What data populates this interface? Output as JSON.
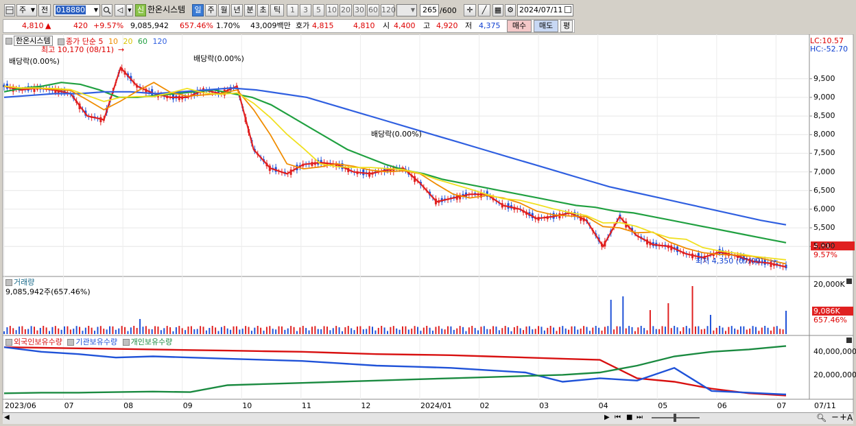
{
  "toolbar": {
    "type_label": "주",
    "prev_label": "전",
    "code_value": "018880",
    "new_badge": "신",
    "stock_name": "한온시스템",
    "period_buttons": [
      "일",
      "주",
      "월",
      "년",
      "분",
      "초",
      "틱"
    ],
    "interval_buttons": [
      "1",
      "3",
      "5",
      "10",
      "20",
      "30",
      "60",
      "120"
    ],
    "count_value": "265",
    "count_max": "/600",
    "date_value": "2024/07/11"
  },
  "quote": {
    "price": "4,810",
    "arrow": "▲",
    "change": "420",
    "change_pct": "+9.57%",
    "volume": "9,085,942",
    "volume_ratio": "657.46%",
    "turnover": "1.70%",
    "amount": "43,009백만",
    "ask_label": "호가",
    "ask": "4,815",
    "bid": "4,810",
    "open_label": "시",
    "open": "4,400",
    "high_label": "고",
    "high": "4,920",
    "low_label": "저",
    "low": "4,375",
    "buy_button": "매수",
    "sell_button": "매도",
    "eval_button": "평"
  },
  "price_panel": {
    "title": "한온시스템",
    "legend_prefix": "종가 단순",
    "ma_periods": [
      "5",
      "10",
      "20",
      "60",
      "120"
    ],
    "ma_colors": [
      "#e02020",
      "#f08c00",
      "#f0e020",
      "#20a040",
      "#2f5fe0"
    ],
    "lc_label": "LC:10.57",
    "hc_label": "HC:-52.70",
    "high_annotation": "최고 10,170 (08/11)",
    "low_annotation": "최저 4,350 (07/09)",
    "dividend_label": "배당락(0.00%)",
    "current_price_tag": "4,810",
    "current_pct_tag": "9.57%",
    "y_ticks": [
      "9,500",
      "9,000",
      "8,500",
      "8,000",
      "7,500",
      "7,000",
      "6,500",
      "6,000",
      "5,500",
      "5,000"
    ],
    "y_range": [
      4250,
      10600
    ]
  },
  "volume_panel": {
    "title": "거래량",
    "value_label": "9,085,942주(657.46%)",
    "y_tick": "20,000K",
    "current_tag": "9,086K",
    "current_pct_tag": "657.46%"
  },
  "holding_panel": {
    "legend": [
      {
        "name": "외국인보유수량",
        "color": "#d81010"
      },
      {
        "name": "기관보유수량",
        "color": "#1f52d8"
      },
      {
        "name": "개인보유수량",
        "color": "#1a8a40"
      }
    ],
    "y_ticks": [
      "40,000,000",
      "20,000,000"
    ],
    "y_range": [
      0,
      50000000
    ]
  },
  "x_axis": {
    "labels": [
      "2023/06",
      "07",
      "08",
      "09",
      "10",
      "11",
      "12",
      "2024/01",
      "02",
      "03",
      "04",
      "05",
      "06",
      "07"
    ],
    "right_label": "07/11"
  },
  "chart_data": {
    "type": "line",
    "title": "한온시스템",
    "x_start": "2023/06",
    "x_end": "2024/07/11",
    "months": [
      "2023/06",
      "07",
      "08",
      "09",
      "10",
      "11",
      "12",
      "2024/01",
      "02",
      "03",
      "04",
      "05",
      "06",
      "07"
    ],
    "series": [
      {
        "name": "종가 5 (MA5)",
        "values": [
          9300,
          9200,
          9250,
          9200,
          9100,
          8500,
          8400,
          9800,
          9300,
          9100,
          9000,
          9000,
          9200,
          9100,
          9300,
          7600,
          7100,
          6950,
          7200,
          7250,
          7200,
          7000,
          6950,
          7050,
          7100,
          6700,
          6200,
          6300,
          6400,
          6400,
          6100,
          6000,
          5750,
          5800,
          5900,
          5700,
          5000,
          5800,
          5300,
          5050,
          5000,
          4800,
          4700,
          4850,
          4750,
          4600,
          4550,
          4450
        ]
      },
      {
        "name": "종가 60 (MA60)",
        "values": [
          9150,
          9250,
          9300,
          9400,
          9350,
          9200,
          9000,
          9000,
          9050,
          9100,
          9150,
          9200,
          9100,
          9000,
          8800,
          8500,
          8200,
          7900,
          7600,
          7400,
          7200,
          7050,
          6950,
          6800,
          6700,
          6600,
          6500,
          6400,
          6300,
          6200,
          6100,
          6050,
          5950,
          5900,
          5800,
          5700,
          5600,
          5500,
          5400,
          5300,
          5200,
          5100
        ]
      },
      {
        "name": "종가 120 (MA120)",
        "values": [
          9000,
          9050,
          9100,
          9100,
          9150,
          9150,
          9100,
          9150,
          9200,
          9250,
          9200,
          9100,
          9000,
          8800,
          8600,
          8400,
          8200,
          8000,
          7800,
          7600,
          7400,
          7200,
          7000,
          6800,
          6600,
          6450,
          6300,
          6150,
          6000,
          5850,
          5700,
          5580
        ]
      }
    ],
    "volume_y_max_label": "20,000K",
    "holding_series": [
      {
        "name": "외국인보유수량",
        "values": [
          44000000,
          43500000,
          43000000,
          42500000,
          42000000,
          41500000,
          41000000,
          40500000,
          40000000,
          39000000,
          38000000,
          37500000,
          37000000,
          36000000,
          35000000,
          34000000,
          33000000,
          17000000,
          14000000,
          8000000,
          4000000,
          2000000
        ]
      },
      {
        "name": "기관보유수량",
        "values": [
          44000000,
          40000000,
          38000000,
          35000000,
          36000000,
          35000000,
          34000000,
          33000000,
          32000000,
          30000000,
          28000000,
          27000000,
          26000000,
          24000000,
          22000000,
          14000000,
          17000000,
          15000000,
          26000000,
          6000000,
          4500000,
          3000000
        ]
      },
      {
        "name": "개인보유수량",
        "values": [
          4000000,
          4500000,
          4500000,
          5000000,
          5500000,
          5000000,
          11000000,
          12000000,
          13000000,
          14000000,
          15000000,
          16000000,
          17000000,
          18000000,
          19000000,
          20000000,
          22000000,
          28000000,
          36000000,
          40000000,
          42000000,
          45000000
        ]
      }
    ]
  }
}
